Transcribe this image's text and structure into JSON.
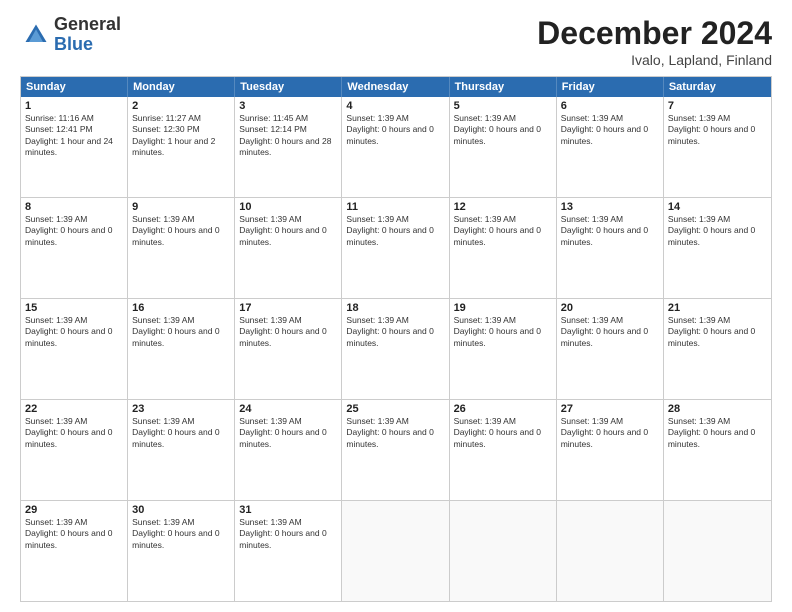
{
  "header": {
    "logo_general": "General",
    "logo_blue": "Blue",
    "title": "December 2024",
    "location": "Ivalo, Lapland, Finland"
  },
  "weekdays": [
    "Sunday",
    "Monday",
    "Tuesday",
    "Wednesday",
    "Thursday",
    "Friday",
    "Saturday"
  ],
  "rows": [
    [
      {
        "day": "1",
        "text": "Sunrise: 11:16 AM\nSunset: 12:41 PM\nDaylight: 1 hour and 24 minutes."
      },
      {
        "day": "2",
        "text": "Sunrise: 11:27 AM\nSunset: 12:30 PM\nDaylight: 1 hour and 2 minutes."
      },
      {
        "day": "3",
        "text": "Sunrise: 11:45 AM\nSunset: 12:14 PM\nDaylight: 0 hours and 28 minutes."
      },
      {
        "day": "4",
        "text": "Sunset: 1:39 AM\nDaylight: 0 hours and 0 minutes."
      },
      {
        "day": "5",
        "text": "Sunset: 1:39 AM\nDaylight: 0 hours and 0 minutes."
      },
      {
        "day": "6",
        "text": "Sunset: 1:39 AM\nDaylight: 0 hours and 0 minutes."
      },
      {
        "day": "7",
        "text": "Sunset: 1:39 AM\nDaylight: 0 hours and 0 minutes."
      }
    ],
    [
      {
        "day": "8",
        "text": "Sunset: 1:39 AM\nDaylight: 0 hours and 0 minutes."
      },
      {
        "day": "9",
        "text": "Sunset: 1:39 AM\nDaylight: 0 hours and 0 minutes."
      },
      {
        "day": "10",
        "text": "Sunset: 1:39 AM\nDaylight: 0 hours and 0 minutes."
      },
      {
        "day": "11",
        "text": "Sunset: 1:39 AM\nDaylight: 0 hours and 0 minutes."
      },
      {
        "day": "12",
        "text": "Sunset: 1:39 AM\nDaylight: 0 hours and 0 minutes."
      },
      {
        "day": "13",
        "text": "Sunset: 1:39 AM\nDaylight: 0 hours and 0 minutes."
      },
      {
        "day": "14",
        "text": "Sunset: 1:39 AM\nDaylight: 0 hours and 0 minutes."
      }
    ],
    [
      {
        "day": "15",
        "text": "Sunset: 1:39 AM\nDaylight: 0 hours and 0 minutes."
      },
      {
        "day": "16",
        "text": "Sunset: 1:39 AM\nDaylight: 0 hours and 0 minutes."
      },
      {
        "day": "17",
        "text": "Sunset: 1:39 AM\nDaylight: 0 hours and 0 minutes."
      },
      {
        "day": "18",
        "text": "Sunset: 1:39 AM\nDaylight: 0 hours and 0 minutes."
      },
      {
        "day": "19",
        "text": "Sunset: 1:39 AM\nDaylight: 0 hours and 0 minutes."
      },
      {
        "day": "20",
        "text": "Sunset: 1:39 AM\nDaylight: 0 hours and 0 minutes."
      },
      {
        "day": "21",
        "text": "Sunset: 1:39 AM\nDaylight: 0 hours and 0 minutes."
      }
    ],
    [
      {
        "day": "22",
        "text": "Sunset: 1:39 AM\nDaylight: 0 hours and 0 minutes."
      },
      {
        "day": "23",
        "text": "Sunset: 1:39 AM\nDaylight: 0 hours and 0 minutes."
      },
      {
        "day": "24",
        "text": "Sunset: 1:39 AM\nDaylight: 0 hours and 0 minutes."
      },
      {
        "day": "25",
        "text": "Sunset: 1:39 AM\nDaylight: 0 hours and 0 minutes."
      },
      {
        "day": "26",
        "text": "Sunset: 1:39 AM\nDaylight: 0 hours and 0 minutes."
      },
      {
        "day": "27",
        "text": "Sunset: 1:39 AM\nDaylight: 0 hours and 0 minutes."
      },
      {
        "day": "28",
        "text": "Sunset: 1:39 AM\nDaylight: 0 hours and 0 minutes."
      }
    ],
    [
      {
        "day": "29",
        "text": "Sunset: 1:39 AM\nDaylight: 0 hours and 0 minutes."
      },
      {
        "day": "30",
        "text": "Sunset: 1:39 AM\nDaylight: 0 hours and 0 minutes."
      },
      {
        "day": "31",
        "text": "Sunset: 1:39 AM\nDaylight: 0 hours and 0 minutes."
      },
      {
        "day": "",
        "text": ""
      },
      {
        "day": "",
        "text": ""
      },
      {
        "day": "",
        "text": ""
      },
      {
        "day": "",
        "text": ""
      }
    ]
  ]
}
